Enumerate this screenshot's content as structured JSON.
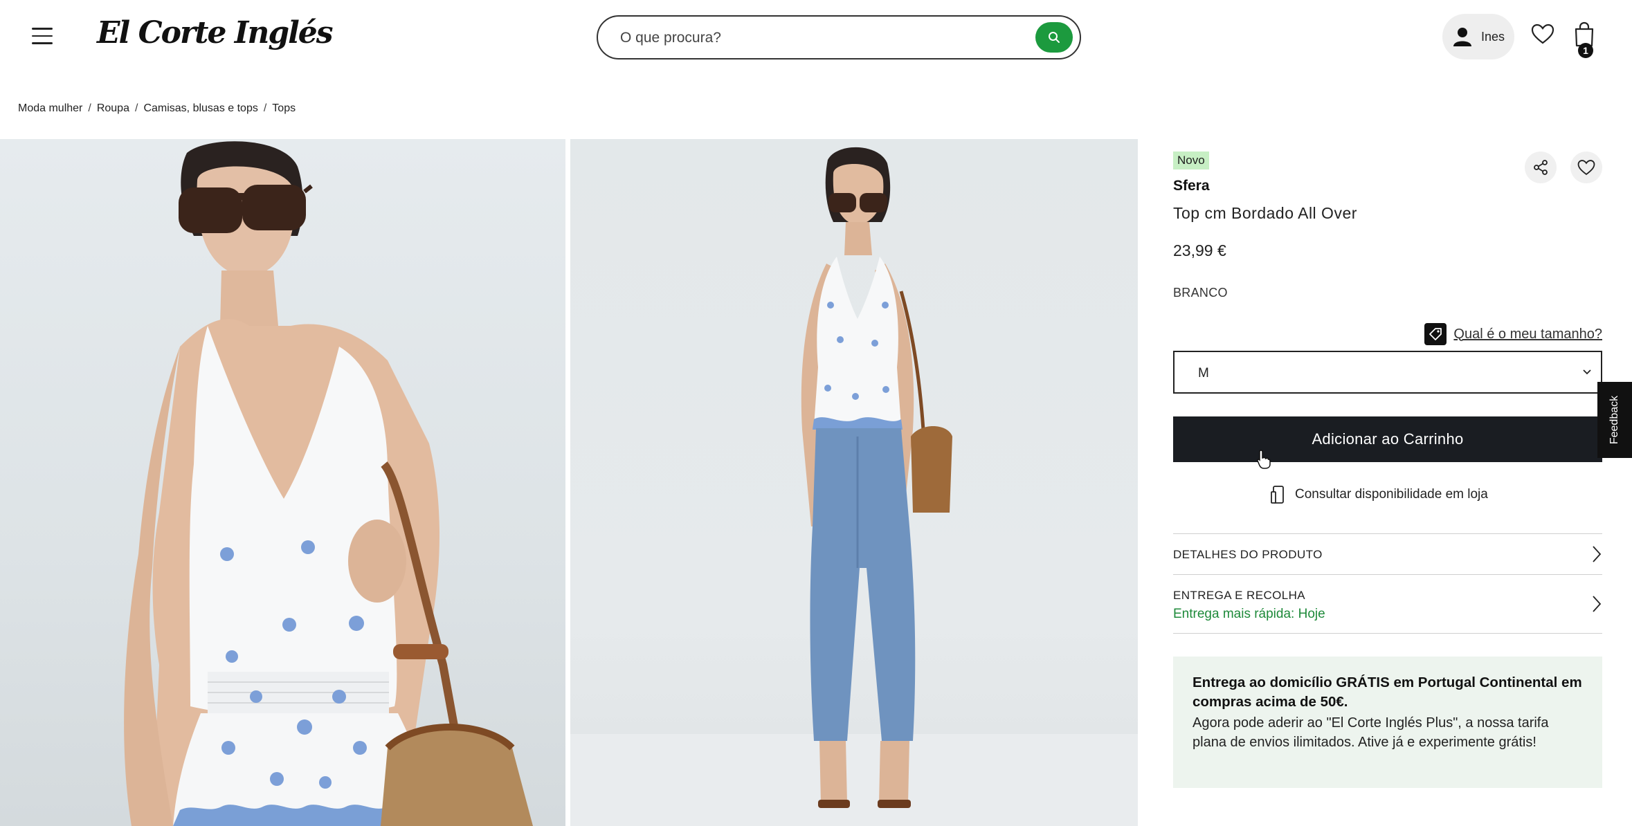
{
  "header": {
    "logo_text": "El Corte Inglés",
    "search_placeholder": "O que procura?",
    "user_name": "Ines",
    "cart_count": "1"
  },
  "breadcrumb": [
    "Moda mulher",
    "Roupa",
    "Camisas, blusas e tops",
    "Tops"
  ],
  "product": {
    "badge": "Novo",
    "brand": "Sfera",
    "title": "Top cm Bordado All Over",
    "price": "23,99 €",
    "color": "BRANCO",
    "size_help": "Qual é o meu tamanho?",
    "selected_size": "M",
    "add_to_cart": "Adicionar ao Carrinho",
    "store_availability": "Consultar disponibilidade em loja"
  },
  "accordion": [
    {
      "label": "DETALHES DO PRODUTO"
    },
    {
      "label": "ENTREGA E RECOLHA",
      "sub": "Entrega mais rápida: Hoje"
    }
  ],
  "promo": {
    "bold": "Entrega ao domicílio GRÁTIS em Portugal Continental em compras acima de 50€.",
    "text": "Agora pode aderir ao \"El Corte Inglés Plus\", a nossa tarifa plana de envios ilimitados. Ative já e experimente grátis!"
  },
  "feedback_label": "Feedback",
  "colors": {
    "accent_green": "#1c9a3e",
    "cta_dark": "#1a1d22",
    "new_badge": "#c7efc4",
    "promo_bg": "#edf4ee"
  }
}
